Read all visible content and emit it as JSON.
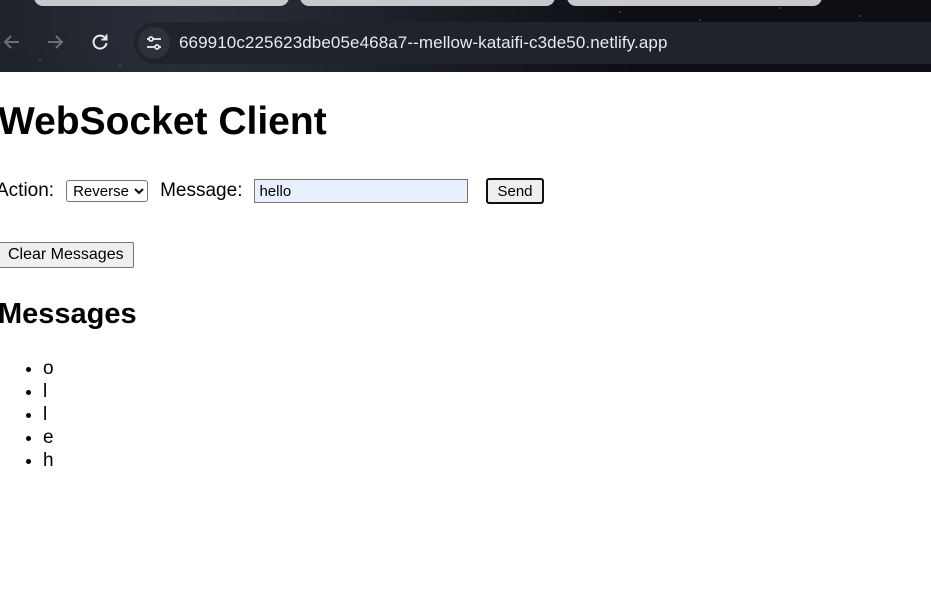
{
  "browser": {
    "url": "669910c225623dbe05e468a7--mellow-kataifi-c3de50.netlify.app",
    "icons": {
      "back": "back-arrow-icon",
      "forward": "forward-arrow-icon",
      "reload": "reload-icon",
      "site_info": "tune-icon"
    }
  },
  "page": {
    "title": "WebSocket Client",
    "action_label": "Action:",
    "action_selected": "Reverse",
    "message_label": "Message:",
    "message_value": "hello",
    "send_label": "Send",
    "clear_label": "Clear Messages",
    "messages_heading": "Messages",
    "messages": [
      "o",
      "l",
      "l",
      "e",
      "h"
    ]
  }
}
